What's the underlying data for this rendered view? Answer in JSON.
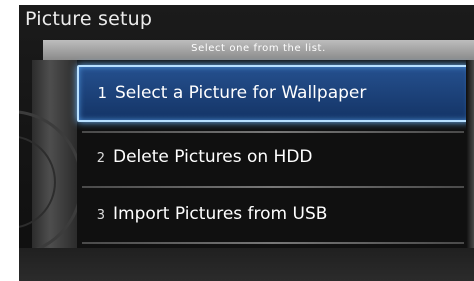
{
  "screen": {
    "title": "Picture setup",
    "instruction": "Select one from the list."
  },
  "menu": {
    "items": [
      {
        "number": "1",
        "label": "Select a Picture for Wallpaper",
        "selected": true
      },
      {
        "number": "2",
        "label": "Delete Pictures on HDD",
        "selected": false
      },
      {
        "number": "3",
        "label": "Import Pictures from USB",
        "selected": false
      }
    ]
  },
  "colors": {
    "highlight": "#1f4a8a",
    "highlight_border": "#b8e0ff",
    "background": "#141414",
    "instruction_bar": "#a6a6a6"
  }
}
